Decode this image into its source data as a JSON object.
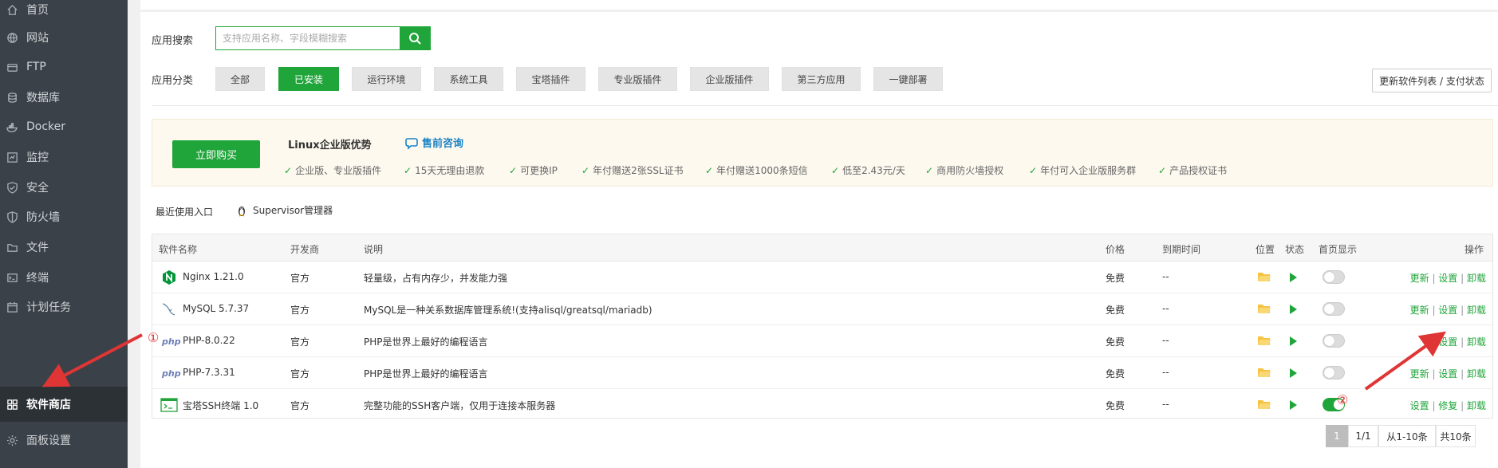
{
  "sidebar": {
    "items": [
      {
        "label": "首页",
        "icon": "home-icon"
      },
      {
        "label": "网站",
        "icon": "globe-icon"
      },
      {
        "label": "FTP",
        "icon": "ftp-icon"
      },
      {
        "label": "数据库",
        "icon": "database-icon"
      },
      {
        "label": "Docker",
        "icon": "docker-icon"
      },
      {
        "label": "监控",
        "icon": "monitor-icon"
      },
      {
        "label": "安全",
        "icon": "shield-check-icon"
      },
      {
        "label": "防火墙",
        "icon": "firewall-shield-icon"
      },
      {
        "label": "文件",
        "icon": "folder-icon"
      },
      {
        "label": "终端",
        "icon": "terminal-icon"
      },
      {
        "label": "计划任务",
        "icon": "calendar-icon"
      },
      {
        "label": "软件商店",
        "icon": "grid-apps-icon",
        "active": true
      },
      {
        "label": "面板设置",
        "icon": "gear-icon"
      }
    ]
  },
  "search": {
    "label": "应用搜索",
    "placeholder": "支持应用名称、字段模糊搜索"
  },
  "categories": {
    "label": "应用分类",
    "items": [
      "全部",
      "已安装",
      "运行环境",
      "系统工具",
      "宝塔插件",
      "专业版插件",
      "企业版插件",
      "第三方应用",
      "一键部署"
    ],
    "active": "已安装"
  },
  "update_button": "更新软件列表 / 支付状态",
  "promo": {
    "buy_button": "立即购买",
    "title": "Linux企业版优势",
    "consult": "售前咨询",
    "features": [
      "企业版、专业版插件",
      "15天无理由退款",
      "可更换IP",
      "年付赠送2张SSL证书",
      "年付赠送1000条短信",
      "低至2.43元/天",
      "商用防火墙授权",
      "年付可入企业版服务群",
      "产品授权证书"
    ]
  },
  "recent": {
    "label": "最近使用入口",
    "item": "Supervisor管理器"
  },
  "table": {
    "headers": {
      "name": "软件名称",
      "developer": "开发商",
      "desc": "说明",
      "price": "价格",
      "expire": "到期时间",
      "location": "位置",
      "status": "状态",
      "homepage": "首页显示",
      "ops": "操作"
    },
    "rows": [
      {
        "name": "Nginx 1.21.0",
        "icon": "nginx-icon",
        "developer": "官方",
        "desc": "轻量级，占有内存少，并发能力强",
        "price": "免费",
        "expire": "--",
        "home_on": false,
        "ops": [
          "更新",
          "设置",
          "卸载"
        ]
      },
      {
        "name": "MySQL 5.7.37",
        "icon": "mysql-dolphin-icon",
        "developer": "官方",
        "desc": "MySQL是一种关系数据库管理系统!(支持alisql/greatsql/mariadb)",
        "price": "免费",
        "expire": "--",
        "home_on": false,
        "ops": [
          "更新",
          "设置",
          "卸载"
        ]
      },
      {
        "name": "PHP-8.0.22",
        "icon": "php-icon",
        "developer": "官方",
        "desc": "PHP是世界上最好的编程语言",
        "price": "免费",
        "expire": "--",
        "home_on": false,
        "ops": [
          "设置",
          "卸载"
        ]
      },
      {
        "name": "PHP-7.3.31",
        "icon": "php-icon",
        "developer": "官方",
        "desc": "PHP是世界上最好的编程语言",
        "price": "免费",
        "expire": "--",
        "home_on": false,
        "ops": [
          "更新",
          "设置",
          "卸载"
        ]
      },
      {
        "name": "宝塔SSH终端 1.0",
        "icon": "ssh-terminal-icon",
        "developer": "官方",
        "desc": "完整功能的SSH客户端，仅用于连接本服务器",
        "price": "免费",
        "expire": "--",
        "home_on": true,
        "ops": [
          "设置",
          "修复",
          "卸载"
        ]
      }
    ]
  },
  "pagination": {
    "current": "1",
    "pages": "1/1",
    "range": "从1-10条",
    "total": "共10条"
  },
  "annotations": {
    "marker_1": "①",
    "marker_2": "②",
    "color": "#e03535"
  },
  "colors": {
    "accent": "#20a53a",
    "sidebar_bg": "#3b4148",
    "link": "#1c84c6"
  }
}
